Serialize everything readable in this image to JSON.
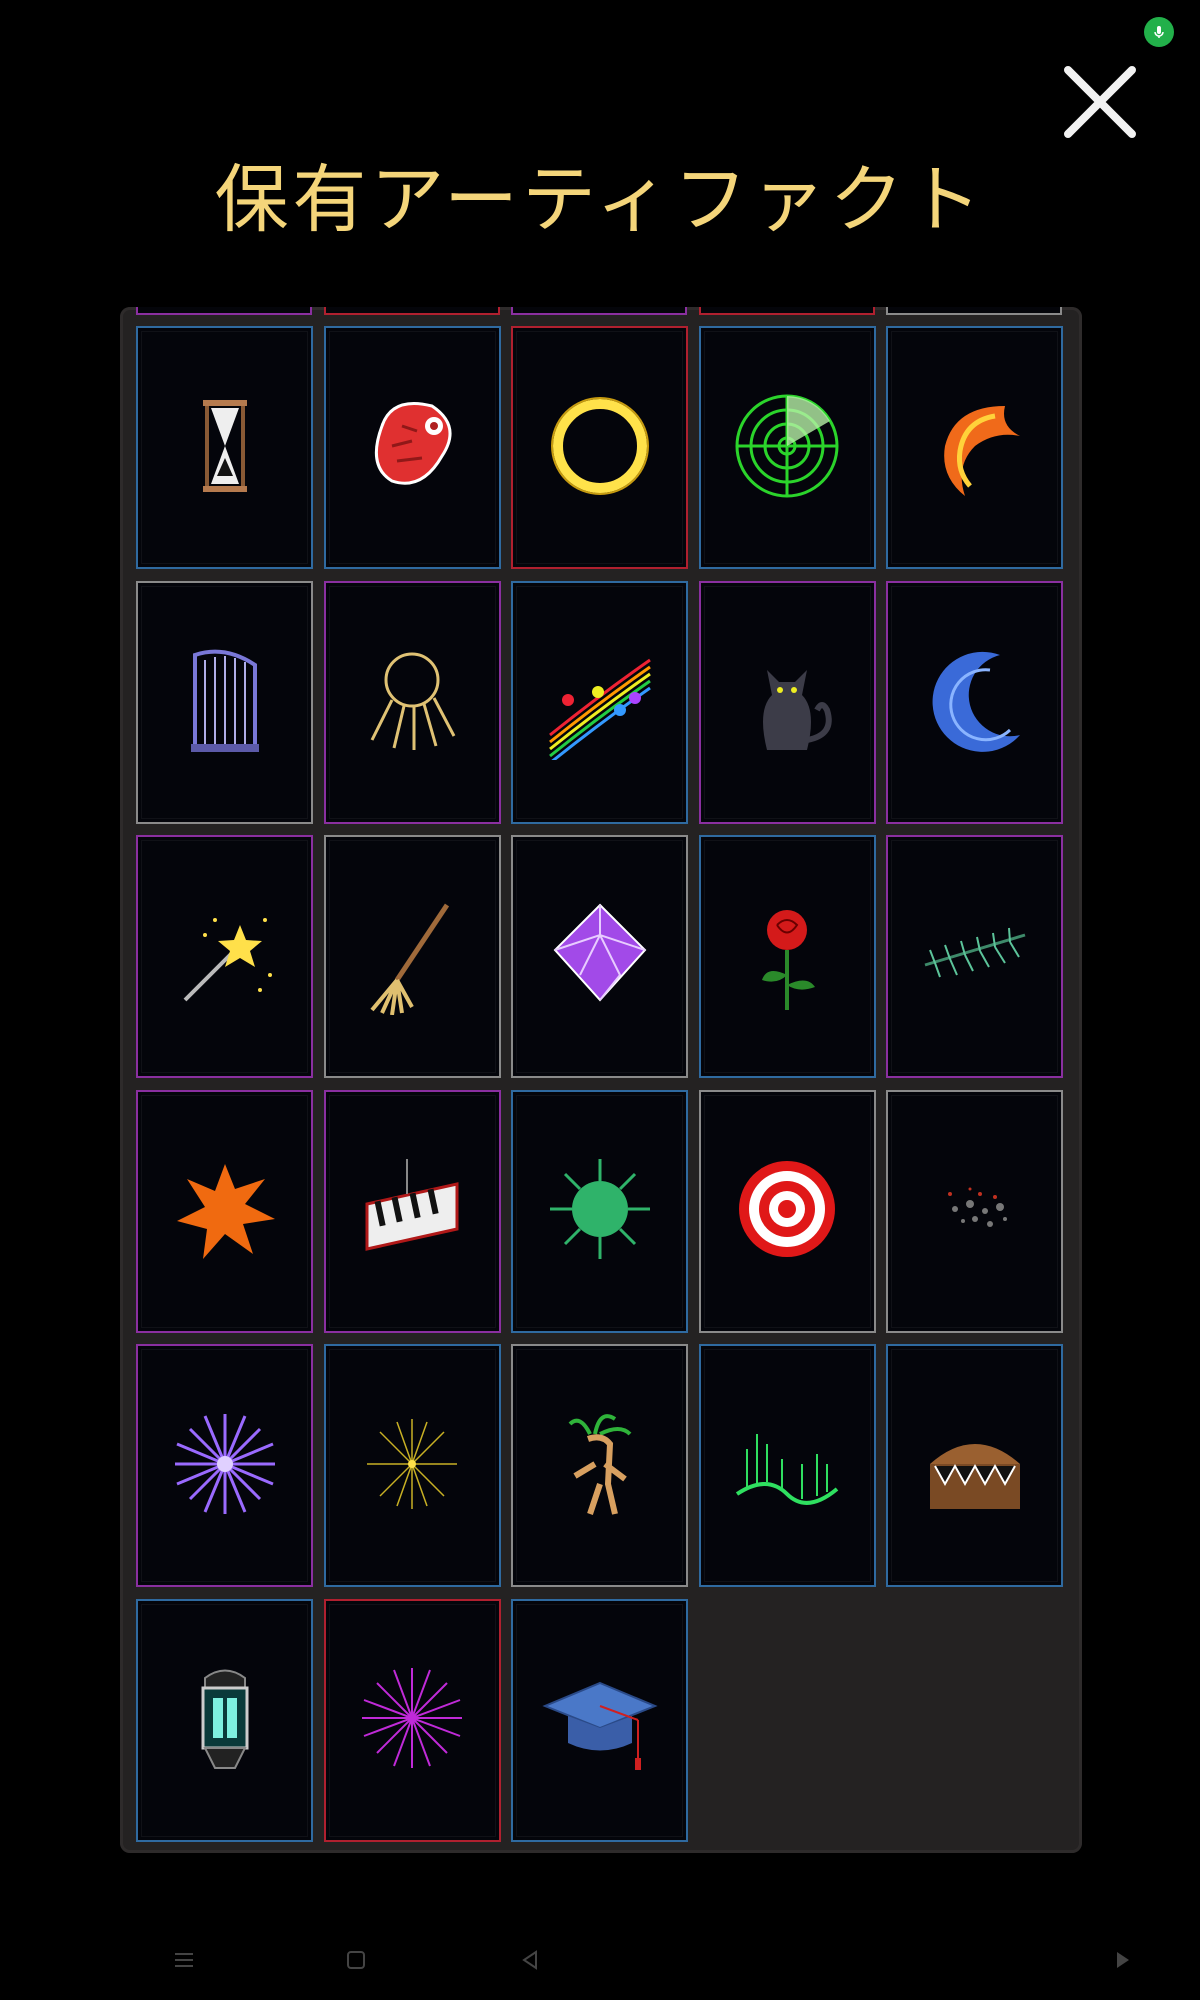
{
  "screen": {
    "title": "保有アーティファクト"
  },
  "colors": {
    "title": "#f4d57a",
    "panel": "#242222",
    "card_bg": "#04050b",
    "border_blue": "#2f6aa0",
    "border_purple": "#8a2fa0",
    "border_red": "#b0202f",
    "border_gray": "#8a8a8a",
    "mic": "#22b04a"
  },
  "artifacts": [
    {
      "icon": "hourglass-icon",
      "border": "blue"
    },
    {
      "icon": "raw-meat-icon",
      "border": "blue"
    },
    {
      "icon": "golden-ring-icon",
      "border": "red"
    },
    {
      "icon": "radar-icon",
      "border": "blue"
    },
    {
      "icon": "fire-serpent-icon",
      "border": "blue"
    },
    {
      "icon": "harp-icon",
      "border": "gray"
    },
    {
      "icon": "key-ring-icon",
      "border": "purple"
    },
    {
      "icon": "music-notes-icon",
      "border": "blue"
    },
    {
      "icon": "black-cat-icon",
      "border": "purple"
    },
    {
      "icon": "crescent-moon-icon",
      "border": "purple"
    },
    {
      "icon": "magic-wand-icon",
      "border": "purple"
    },
    {
      "icon": "broom-icon",
      "border": "gray"
    },
    {
      "icon": "purple-crystal-icon",
      "border": "gray"
    },
    {
      "icon": "red-rose-icon",
      "border": "blue"
    },
    {
      "icon": "cedar-branch-icon",
      "border": "purple"
    },
    {
      "icon": "orange-splatter-icon",
      "border": "purple"
    },
    {
      "icon": "piano-keys-icon",
      "border": "purple"
    },
    {
      "icon": "green-virus-icon",
      "border": "blue"
    },
    {
      "icon": "bullseye-target-icon",
      "border": "gray"
    },
    {
      "icon": "ash-dust-icon",
      "border": "gray"
    },
    {
      "icon": "violet-burst-icon",
      "border": "purple"
    },
    {
      "icon": "yellow-sparkle-icon",
      "border": "blue"
    },
    {
      "icon": "mandrake-root-icon",
      "border": "gray"
    },
    {
      "icon": "aurora-icon",
      "border": "blue"
    },
    {
      "icon": "mimic-chest-icon",
      "border": "blue"
    },
    {
      "icon": "lantern-icon",
      "border": "blue"
    },
    {
      "icon": "magenta-burst-icon",
      "border": "red"
    },
    {
      "icon": "graduation-cap-icon",
      "border": "blue"
    }
  ],
  "top_strip": [
    "purple",
    "red",
    "purple",
    "red",
    "gray"
  ],
  "nav": {
    "items": [
      "menu-icon",
      "home-icon",
      "back-icon",
      "play-icon"
    ]
  }
}
